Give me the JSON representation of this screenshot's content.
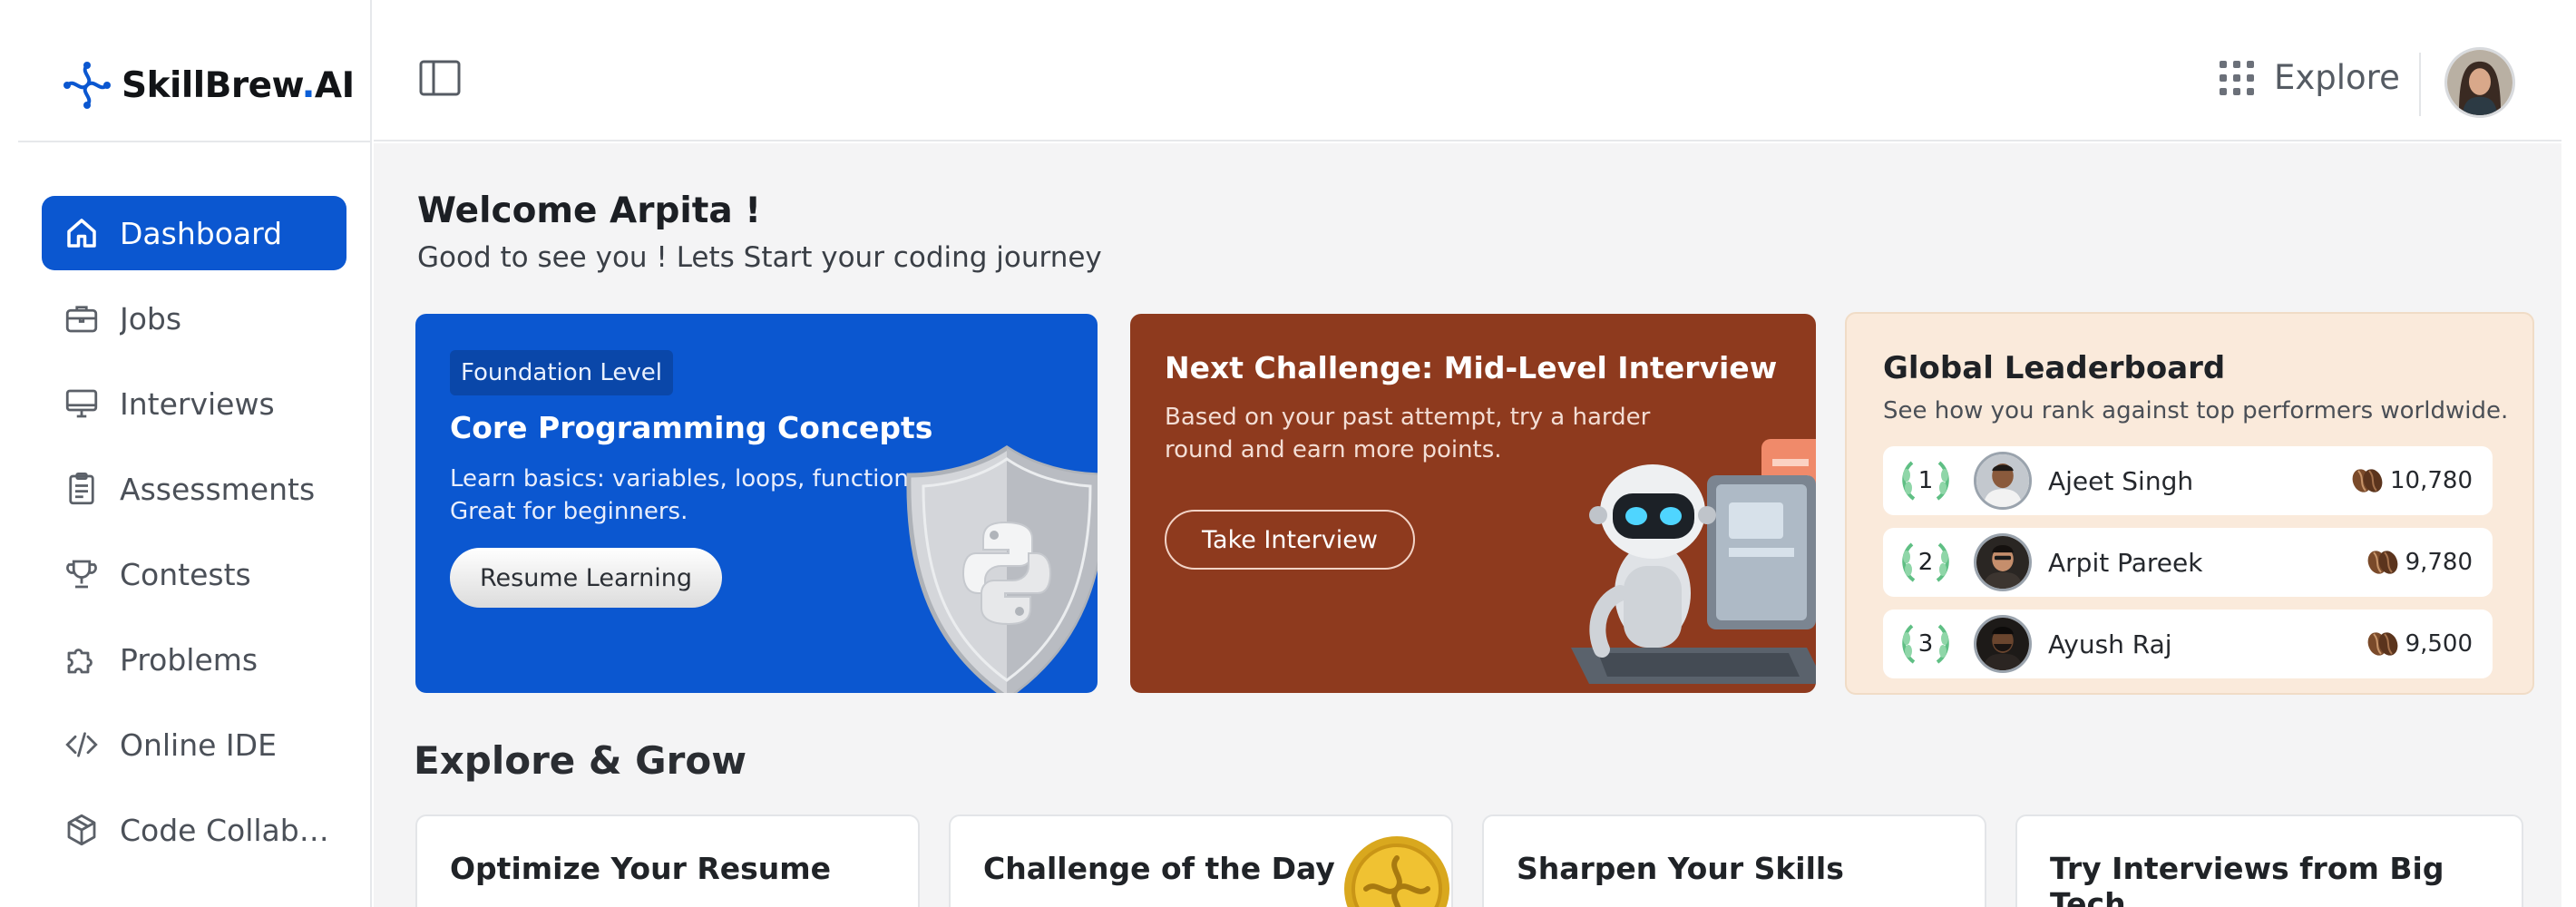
{
  "app": {
    "logo_text": "SkillBrew",
    "logo_suffix": "AI",
    "logo_dot": ".",
    "accent": "#0b57d0"
  },
  "sidebar": {
    "items": [
      {
        "label": "Dashboard",
        "icon": "home-icon",
        "active": true
      },
      {
        "label": "Jobs",
        "icon": "briefcase-icon",
        "active": false
      },
      {
        "label": "Interviews",
        "icon": "monitor-icon",
        "active": false
      },
      {
        "label": "Assessments",
        "icon": "clipboard-icon",
        "active": false
      },
      {
        "label": "Contests",
        "icon": "trophy-icon",
        "active": false
      },
      {
        "label": "Problems",
        "icon": "puzzle-icon",
        "active": false
      },
      {
        "label": "Online IDE",
        "icon": "code-icon",
        "active": false
      },
      {
        "label": "Code Collabora...",
        "icon": "cube-icon",
        "active": false
      }
    ]
  },
  "header": {
    "explore_label": "Explore"
  },
  "welcome": {
    "title": "Welcome Arpita !",
    "subtitle": "Good to see you ! Lets Start your coding journey"
  },
  "cards": {
    "course": {
      "badge": "Foundation Level",
      "title": "Core Programming Concepts",
      "desc_line1": "Learn basics: variables, loops, functions.",
      "desc_line2": "Great for beginners.",
      "button": "Resume Learning"
    },
    "challenge": {
      "title": "Next Challenge: Mid-Level Interview",
      "desc_line1": "Based on your past attempt, try a harder",
      "desc_line2": "round and earn more points.",
      "button": "Take Interview"
    },
    "leaderboard": {
      "title": "Global Leaderboard",
      "subtitle": "See how you rank against top performers worldwide.",
      "rows": [
        {
          "rank": "1",
          "name": "Ajeet Singh",
          "points": "10,780"
        },
        {
          "rank": "2",
          "name": "Arpit Pareek",
          "points": "9,780"
        },
        {
          "rank": "3",
          "name": "Ayush Raj",
          "points": "9,500"
        }
      ]
    }
  },
  "explore_grow": {
    "title": "Explore & Grow",
    "cards": [
      {
        "title": "Optimize Your Resume"
      },
      {
        "title": "Challenge of the Day"
      },
      {
        "title": "Sharpen Your Skills"
      },
      {
        "title": "Try Interviews from Big Tech"
      }
    ]
  }
}
